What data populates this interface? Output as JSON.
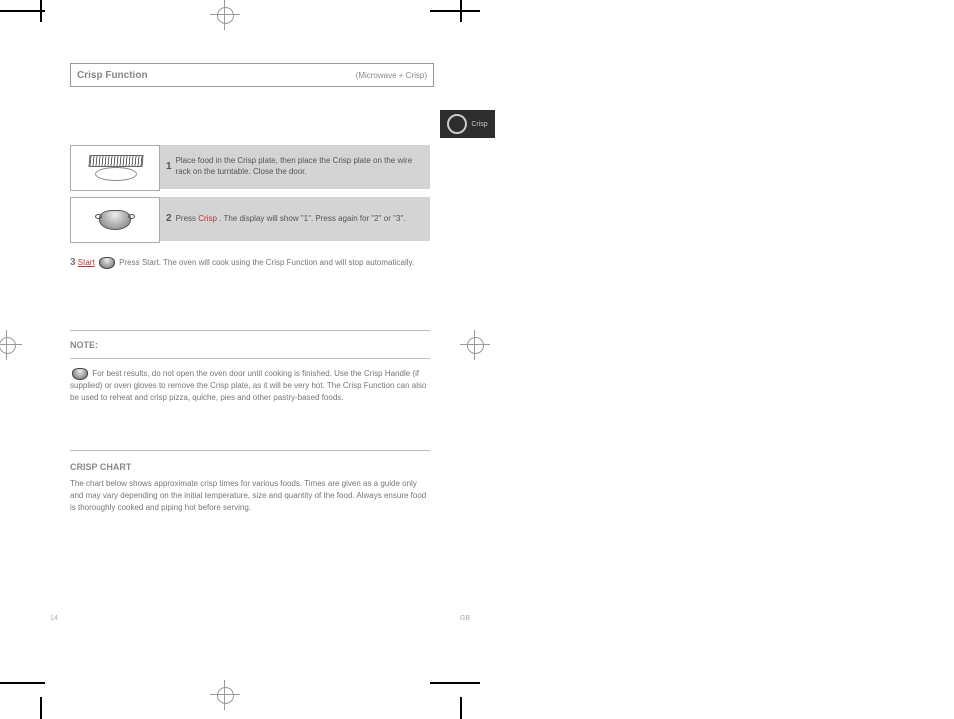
{
  "page": {
    "title": "Crisp Function",
    "title_sub": "(Microwave + Crisp)",
    "tab_label": "Crisp",
    "step1": {
      "num": "1",
      "text": "Place food in the Crisp plate, then place the Crisp plate on the wire rack on the turntable. Close the door."
    },
    "step2": {
      "num": "2",
      "pre": "Press",
      "icon_label": "Crisp",
      "rest": ". The display will show \"1\".",
      "hint": "Press again for \"2\" or \"3\"."
    },
    "line3": "Press Start. The oven will cook using the Crisp Function and will stop automatically.",
    "note_head": "NOTE:",
    "note_text": " For best results, do not open the oven door until cooking is finished. Use the Crisp Handle (if supplied) or oven gloves to remove the Crisp plate, as it will be very hot. The Crisp Function can also be used to reheat and crisp pizza, quiche, pies and other pastry-based foods.",
    "chart_head": "CRISP CHART",
    "chart_body": "The chart below shows approximate crisp times for various foods. Times are given as a guide only and may vary depending on the initial temperature, size and quantity of the food. Always ensure food is thoroughly cooked and piping hot before serving.",
    "footer_page": "14",
    "footer_right": "GB"
  }
}
